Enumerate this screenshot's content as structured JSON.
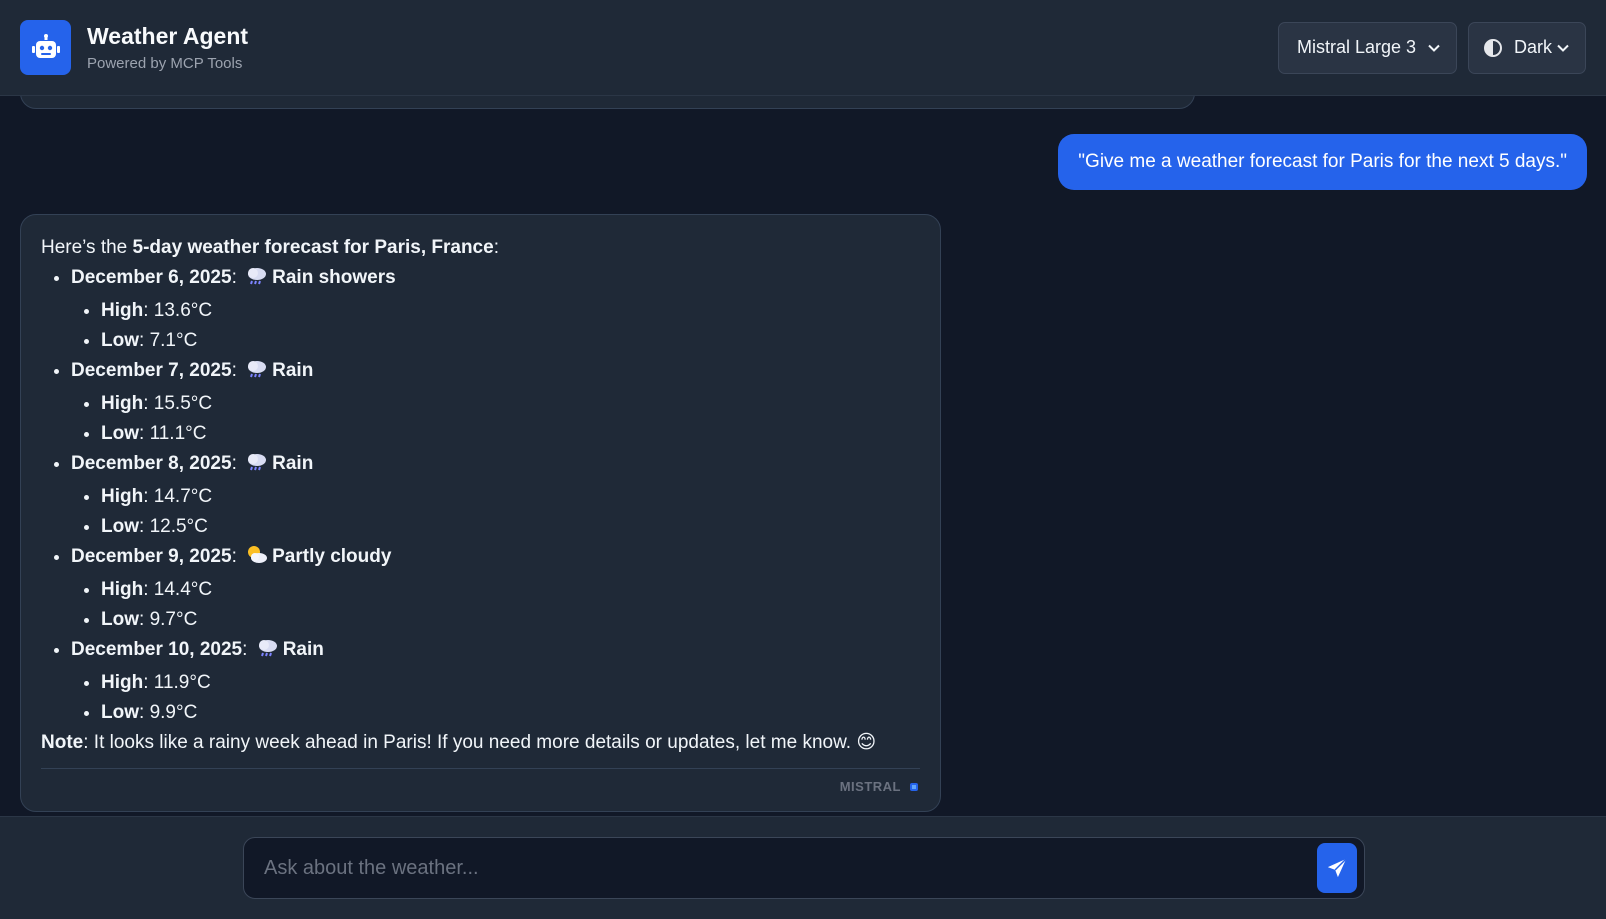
{
  "header": {
    "title": "Weather Agent",
    "subtitle": "Powered by MCP Tools",
    "model_select": {
      "value": "Mistral Large 3"
    },
    "theme_select": {
      "value": "Dark"
    }
  },
  "chat": {
    "user_message": "\"Give me a weather forecast for Paris for the next 5 days.\"",
    "bot_message": {
      "intro_prefix": "Here’s the ",
      "intro_bold": "5-day weather forecast for Paris, France",
      "intro_suffix": ":",
      "days": [
        {
          "date": "December 6, 2025",
          "icon": "rain-cloud-icon",
          "condition": "Rain showers",
          "high_label": "High",
          "high": "13.6°C",
          "low_label": "Low",
          "low": "7.1°C"
        },
        {
          "date": "December 7, 2025",
          "icon": "rain-cloud-icon",
          "condition": "Rain",
          "high_label": "High",
          "high": "15.5°C",
          "low_label": "Low",
          "low": "11.1°C"
        },
        {
          "date": "December 8, 2025",
          "icon": "rain-cloud-icon",
          "condition": "Rain",
          "high_label": "High",
          "high": "14.7°C",
          "low_label": "Low",
          "low": "12.5°C"
        },
        {
          "date": "December 9, 2025",
          "icon": "sun-behind-cloud-icon",
          "condition": "Partly cloudy",
          "high_label": "High",
          "high": "14.4°C",
          "low_label": "Low",
          "low": "9.7°C"
        },
        {
          "date": "December 10, 2025",
          "icon": "rain-cloud-icon",
          "condition": "Rain",
          "high_label": "High",
          "high": "11.9°C",
          "low_label": "Low",
          "low": "9.9°C"
        }
      ],
      "note_label": "Note",
      "note_text": ": It looks like a rainy week ahead in Paris! If you need more details or updates, let me know.",
      "note_emoji": "😊",
      "footer_label": "MISTRAL"
    }
  },
  "input": {
    "placeholder": "Ask about the weather..."
  },
  "colors": {
    "accent": "#2563eb",
    "background": "#111827",
    "panel": "#1f2937",
    "border": "#334155"
  }
}
